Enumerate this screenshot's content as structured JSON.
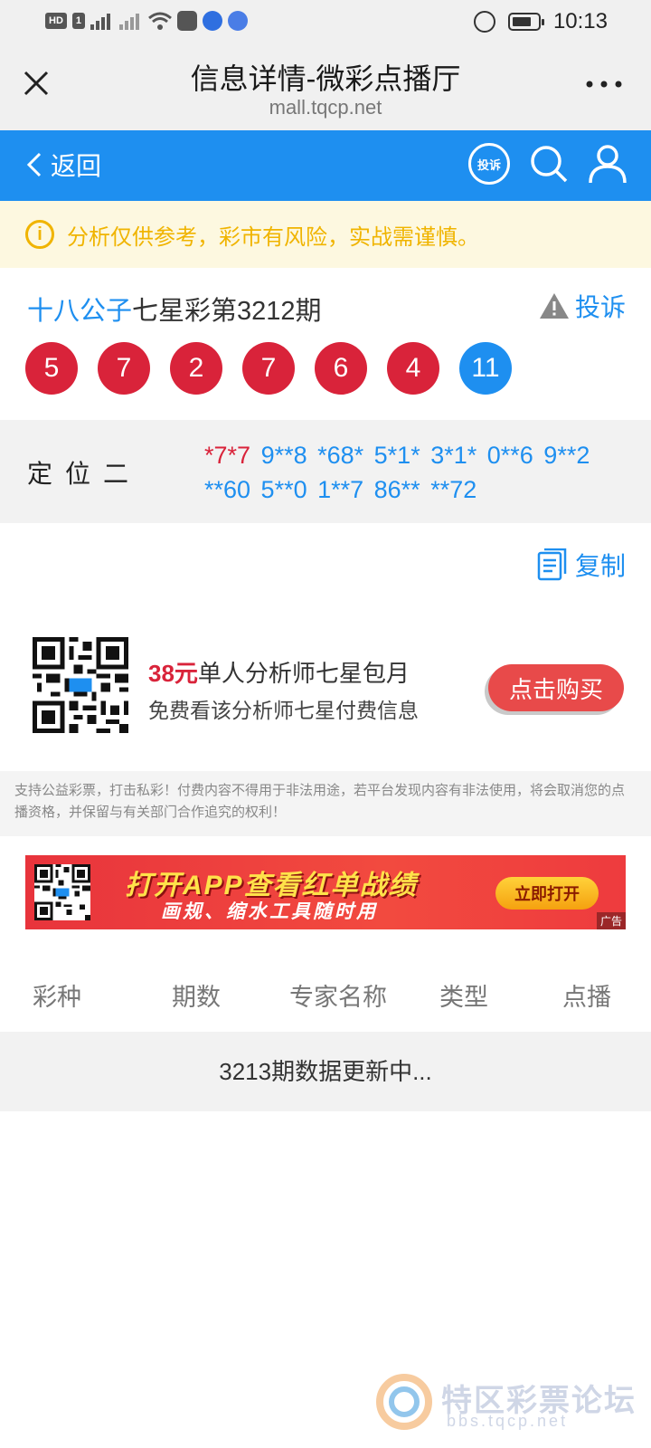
{
  "status_bar": {
    "network_badge": "HD",
    "sim_slot": "1",
    "time": "10:13"
  },
  "browser": {
    "title": "信息详情-微彩点播厅",
    "url": "mall.tqcp.net"
  },
  "nav": {
    "back_label": "返回",
    "complain_icon_label": "投诉"
  },
  "notice": {
    "text": "分析仅供参考，彩市有风险，实战需谨慎。"
  },
  "issue": {
    "expert_name": "十八公子",
    "title_rest": "七星彩第3212期",
    "complain_label": "投诉",
    "balls": [
      "5",
      "7",
      "2",
      "7",
      "6",
      "4"
    ],
    "special_ball": "11"
  },
  "position": {
    "label": "定位二",
    "highlight_combo": "*7*7",
    "combos": "9**8 *68* 5*1* 3*1* 0**6 9**2 **60 5**0 1**7 86** **72"
  },
  "copy": {
    "label": "复制"
  },
  "promo": {
    "price": "38元",
    "title": "单人分析师七星包月",
    "subtitle": "免费看该分析师七星付费信息",
    "buy_label": "点击购买"
  },
  "disclaimer": {
    "text": "支持公益彩票，打击私彩！付费内容不得用于非法用途，若平台发现内容有非法使用，将会取消您的点播资格，并保留与有关部门合作追究的权利！"
  },
  "banner": {
    "headline": "打开APP查看红单战绩",
    "subline": "画规、缩水工具随时用",
    "button": "立即打开",
    "ad_tag": "广告"
  },
  "table": {
    "headers": [
      "彩种",
      "期数",
      "专家名称",
      "类型",
      "点播"
    ],
    "status": "3213期数据更新中..."
  },
  "watermark": {
    "title": "特区彩票论坛",
    "url": "bbs.tqcp.net"
  },
  "colors": {
    "brand_blue": "#1e8ff0",
    "ball_red": "#d9233a",
    "notice_yellow": "#f0b400",
    "buy_red": "#e84a4a"
  }
}
